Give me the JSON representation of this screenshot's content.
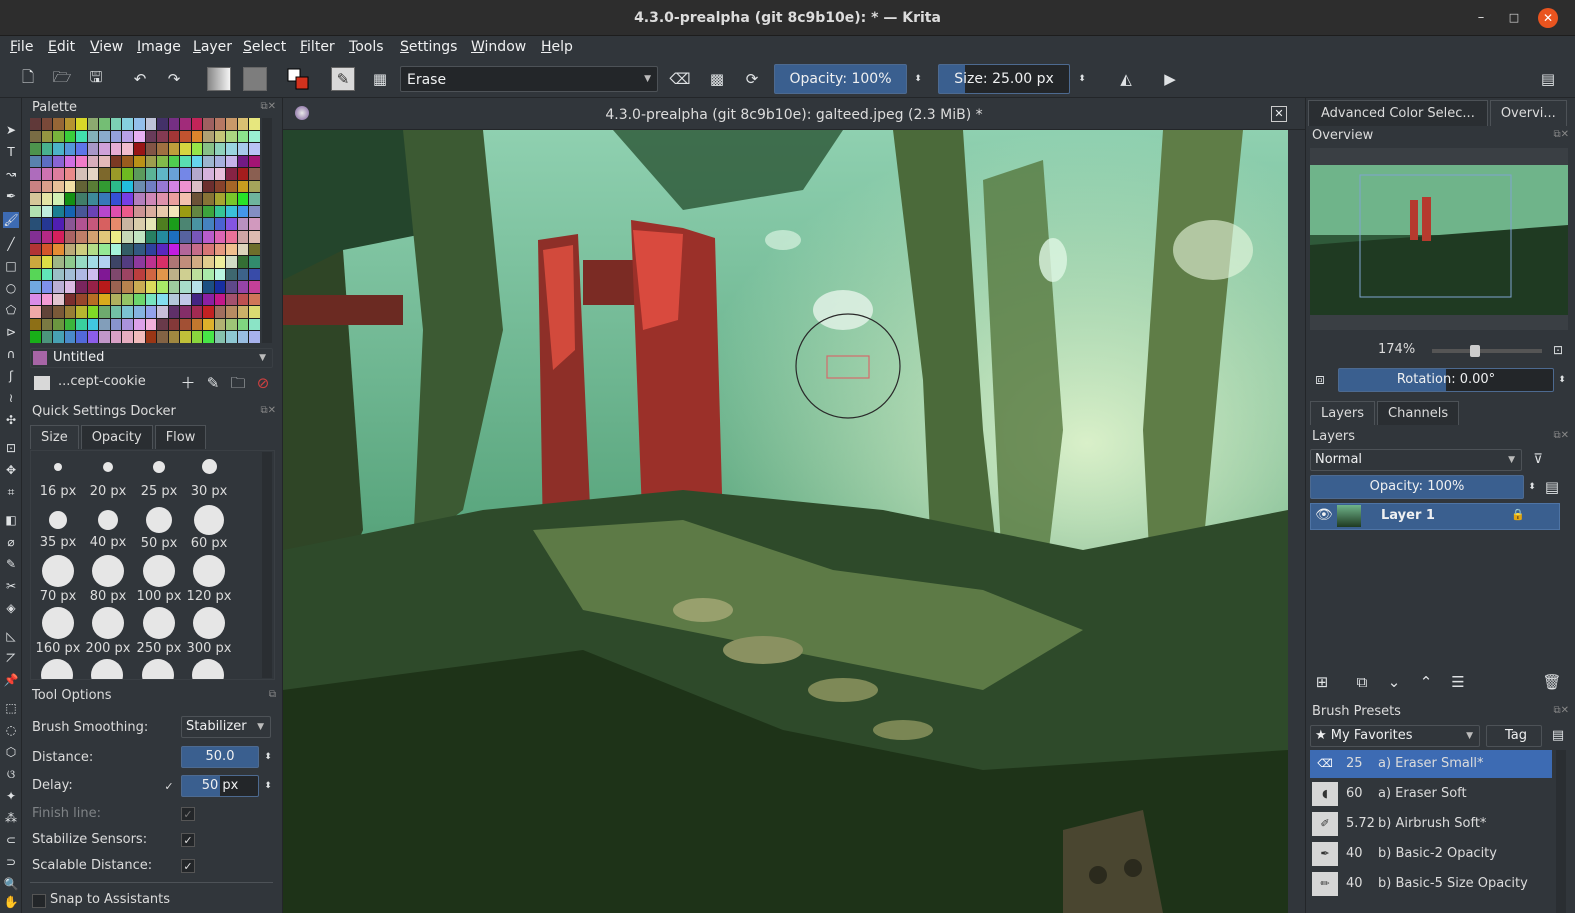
{
  "window": {
    "title": "4.3.0-prealpha (git 8c9b10e):  * — Krita",
    "minimize": "–",
    "maximize": "□",
    "close": "✕"
  },
  "menu": [
    "File",
    "Edit",
    "View",
    "Image",
    "Layer",
    "Select",
    "Filter",
    "Tools",
    "Settings",
    "Window",
    "Help"
  ],
  "toolbar": {
    "preset_name": "Erase",
    "opacity": "Opacity: 100%",
    "size": "Size: 25.00 px"
  },
  "palette": {
    "title": "Palette",
    "name": "Untitled",
    "set_name": "...cept-cookie"
  },
  "quick_settings": {
    "title": "Quick Settings Docker",
    "tabs": [
      "Size",
      "Opacity",
      "Flow"
    ],
    "sizes": [
      "16 px",
      "20 px",
      "25 px",
      "30 px",
      "35 px",
      "40 px",
      "50 px",
      "60 px",
      "70 px",
      "80 px",
      "100 px",
      "120 px",
      "160 px",
      "200 px",
      "250 px",
      "300 px"
    ]
  },
  "tool_options": {
    "title": "Tool Options",
    "smoothing_label": "Brush Smoothing:",
    "smoothing_value": "Stabilizer",
    "distance_label": "Distance:",
    "distance_value": "50.0",
    "delay_label": "Delay:",
    "delay_value": "50 px",
    "finish_label": "Finish line:",
    "stabilize_label": "Stabilize Sensors:",
    "scalable_label": "Scalable Distance:",
    "snap_label": "Snap to Assistants"
  },
  "document": {
    "title": "4.3.0-prealpha (git 8c9b10e): galteed.jpeg (2.3 MiB) *"
  },
  "right": {
    "tab_color": "Advanced Color Selec...",
    "tab_overview": "Overvi...",
    "overview_title": "Overview",
    "zoom": "174%",
    "rotation": "Rotation: 0.00°",
    "layer_tabs": [
      "Layers",
      "Channels"
    ],
    "layers_title": "Layers",
    "blend_mode": "Normal",
    "layer_opacity": "Opacity:  100%",
    "layer_name": "Layer 1",
    "presets_title": "Brush Presets",
    "preset_tag": "★ My Favorites",
    "tag_button": "Tag",
    "presets": [
      {
        "num": "25",
        "name": "a) Eraser Small*"
      },
      {
        "num": "60",
        "name": "a) Eraser Soft"
      },
      {
        "num": "5.72",
        "name": "b) Airbrush Soft*"
      },
      {
        "num": "40",
        "name": "b) Basic-2 Opacity"
      },
      {
        "num": "40",
        "name": "b) Basic-5 Size Opacity"
      }
    ]
  }
}
